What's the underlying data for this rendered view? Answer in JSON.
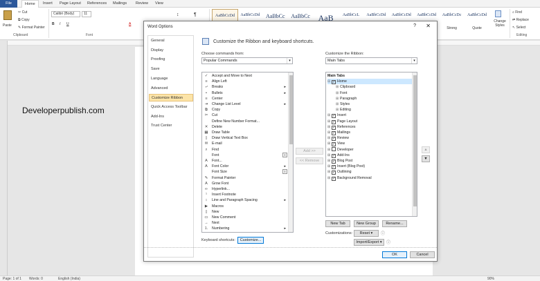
{
  "tabs": [
    "File",
    "Home",
    "Insert",
    "Page Layout",
    "References",
    "Mailings",
    "Review",
    "View"
  ],
  "ribbon": {
    "clipboard": {
      "paste": "Paste",
      "cut": "Cut",
      "copy": "Copy",
      "format_painter": "Format Painter",
      "label": "Clipboard"
    },
    "font": {
      "name": "Calibri (Body)",
      "size": "11",
      "label": "Font"
    },
    "styles": [
      {
        "sample": "AaBbCcDd",
        "name": "",
        "selected": true
      },
      {
        "sample": "AaBbCcDd",
        "name": ""
      },
      {
        "sample": "AaBbCc",
        "name": ""
      },
      {
        "sample": "AaBbCc",
        "name": ""
      },
      {
        "sample": "AaB",
        "name": ""
      },
      {
        "sample": "AaBbCcL",
        "name": ""
      },
      {
        "sample": "AaBbCcDd",
        "name": ""
      },
      {
        "sample": "AaBbCcDd",
        "name": ""
      },
      {
        "sample": "AaBbCcDd",
        "name": ""
      },
      {
        "sample": "AaBbCcDc",
        "name": "Strong"
      },
      {
        "sample": "AaBbCcDd",
        "name": "Quote"
      }
    ],
    "change_styles": "Change Styles",
    "editing": {
      "find": "Find",
      "replace": "Replace",
      "select": "Select",
      "label": "Editing"
    }
  },
  "document": {
    "text": "Developerpublish.com"
  },
  "statusbar": {
    "page": "Page: 1 of 1",
    "words": "Words: 0",
    "language": "English (India)",
    "zoom": "90%"
  },
  "dialog": {
    "title": "Word Options",
    "help": "?",
    "close": "✕",
    "nav": [
      "General",
      "Display",
      "Proofing",
      "Save",
      "Language",
      "Advanced",
      "Customize Ribbon",
      "Quick Access Toolbar",
      "Add-Ins",
      "Trust Center"
    ],
    "nav_selected": 6,
    "header": "Customize the Ribbon and keyboard shortcuts.",
    "choose_label": "Choose commands from:",
    "choose_value": "Popular Commands",
    "customize_label": "Customize the Ribbon:",
    "customize_value": "Main Tabs",
    "commands": [
      {
        "label": "Accept and Move to Next",
        "icon": "accept-icon",
        "glyph": "✓"
      },
      {
        "label": "Align Left",
        "icon": "align-left-icon",
        "glyph": "≡"
      },
      {
        "label": "Breaks",
        "icon": "breaks-icon",
        "glyph": "⤶",
        "sub": true
      },
      {
        "label": "Bullets",
        "icon": "bullets-icon",
        "glyph": "•",
        "sub": true
      },
      {
        "label": "Center",
        "icon": "center-icon",
        "glyph": "≡"
      },
      {
        "label": "Change List Level",
        "icon": "list-level-icon",
        "glyph": "⇥",
        "sub": true
      },
      {
        "label": "Copy",
        "icon": "copy-icon",
        "glyph": "⧉"
      },
      {
        "label": "Cut",
        "icon": "cut-icon",
        "glyph": "✂"
      },
      {
        "label": "Define New Number Format...",
        "icon": "",
        "glyph": ""
      },
      {
        "label": "Delete",
        "icon": "delete-icon",
        "glyph": "✕"
      },
      {
        "label": "Draw Table",
        "icon": "draw-table-icon",
        "glyph": "▦"
      },
      {
        "label": "Draw Vertical Text Box",
        "icon": "text-box-icon",
        "glyph": "▯"
      },
      {
        "label": "E-mail",
        "icon": "email-icon",
        "glyph": "✉"
      },
      {
        "label": "Find",
        "icon": "find-icon",
        "glyph": "⌕"
      },
      {
        "label": "Font",
        "icon": "",
        "glyph": "",
        "fb": "I"
      },
      {
        "label": "Font...",
        "icon": "font-dialog-icon",
        "glyph": "A"
      },
      {
        "label": "Font Color",
        "icon": "font-color-icon",
        "glyph": "A",
        "sub": true
      },
      {
        "label": "Font Size",
        "icon": "",
        "glyph": "",
        "fb": "I"
      },
      {
        "label": "Format Painter",
        "icon": "format-painter-icon",
        "glyph": "✎"
      },
      {
        "label": "Grow Font",
        "icon": "grow-font-icon",
        "glyph": "A"
      },
      {
        "label": "Hyperlink...",
        "icon": "hyperlink-icon",
        "glyph": "∞"
      },
      {
        "label": "Insert Footnote",
        "icon": "footnote-icon",
        "glyph": "¹"
      },
      {
        "label": "Line and Paragraph Spacing",
        "icon": "line-spacing-icon",
        "glyph": "↕",
        "sub": true
      },
      {
        "label": "Macros",
        "icon": "macros-icon",
        "glyph": "▶"
      },
      {
        "label": "New",
        "icon": "new-icon",
        "glyph": "▯"
      },
      {
        "label": "New Comment",
        "icon": "comment-icon",
        "glyph": "▭"
      },
      {
        "label": "Next",
        "icon": "next-icon",
        "glyph": "→"
      },
      {
        "label": "Numbering",
        "icon": "numbering-icon",
        "glyph": "⒈",
        "sub": true
      }
    ],
    "tree_header": "Main Tabs",
    "tree": [
      {
        "label": "Home",
        "level": 0,
        "exp": "⊟",
        "checked": true,
        "hl": true
      },
      {
        "label": "Clipboard",
        "level": 1,
        "exp": "⊞",
        "checked": null
      },
      {
        "label": "Font",
        "level": 1,
        "exp": "⊞",
        "checked": null
      },
      {
        "label": "Paragraph",
        "level": 1,
        "exp": "⊞",
        "checked": null
      },
      {
        "label": "Styles",
        "level": 1,
        "exp": "⊞",
        "checked": null
      },
      {
        "label": "Editing",
        "level": 1,
        "exp": "⊞",
        "checked": null
      },
      {
        "label": "Insert",
        "level": 0,
        "exp": "⊞",
        "checked": true
      },
      {
        "label": "Page Layout",
        "level": 0,
        "exp": "⊞",
        "checked": true
      },
      {
        "label": "References",
        "level": 0,
        "exp": "⊞",
        "checked": true
      },
      {
        "label": "Mailings",
        "level": 0,
        "exp": "⊞",
        "checked": true
      },
      {
        "label": "Review",
        "level": 0,
        "exp": "⊞",
        "checked": true
      },
      {
        "label": "View",
        "level": 0,
        "exp": "⊞",
        "checked": true
      },
      {
        "label": "Developer",
        "level": 0,
        "exp": "⊞",
        "checked": false
      },
      {
        "label": "Add-Ins",
        "level": 0,
        "exp": "⊞",
        "checked": true
      },
      {
        "label": "Blog Post",
        "level": 0,
        "exp": "⊞",
        "checked": true
      },
      {
        "label": "Insert (Blog Post)",
        "level": 0,
        "exp": "⊞",
        "checked": true
      },
      {
        "label": "Outlining",
        "level": 0,
        "exp": "⊞",
        "checked": true
      },
      {
        "label": "Background Removal",
        "level": 0,
        "exp": "⊞",
        "checked": true
      }
    ],
    "add_btn": "Add >>",
    "remove_btn": "<< Remove",
    "new_tab": "New Tab",
    "new_group": "New Group",
    "rename": "Rename...",
    "customizations_label": "Customizations:",
    "reset": "Reset ▾",
    "import_export": "Import/Export ▾",
    "keyboard_label": "Keyboard shortcuts:",
    "customize_btn": "Customize...",
    "ok": "OK",
    "cancel": "Cancel"
  }
}
